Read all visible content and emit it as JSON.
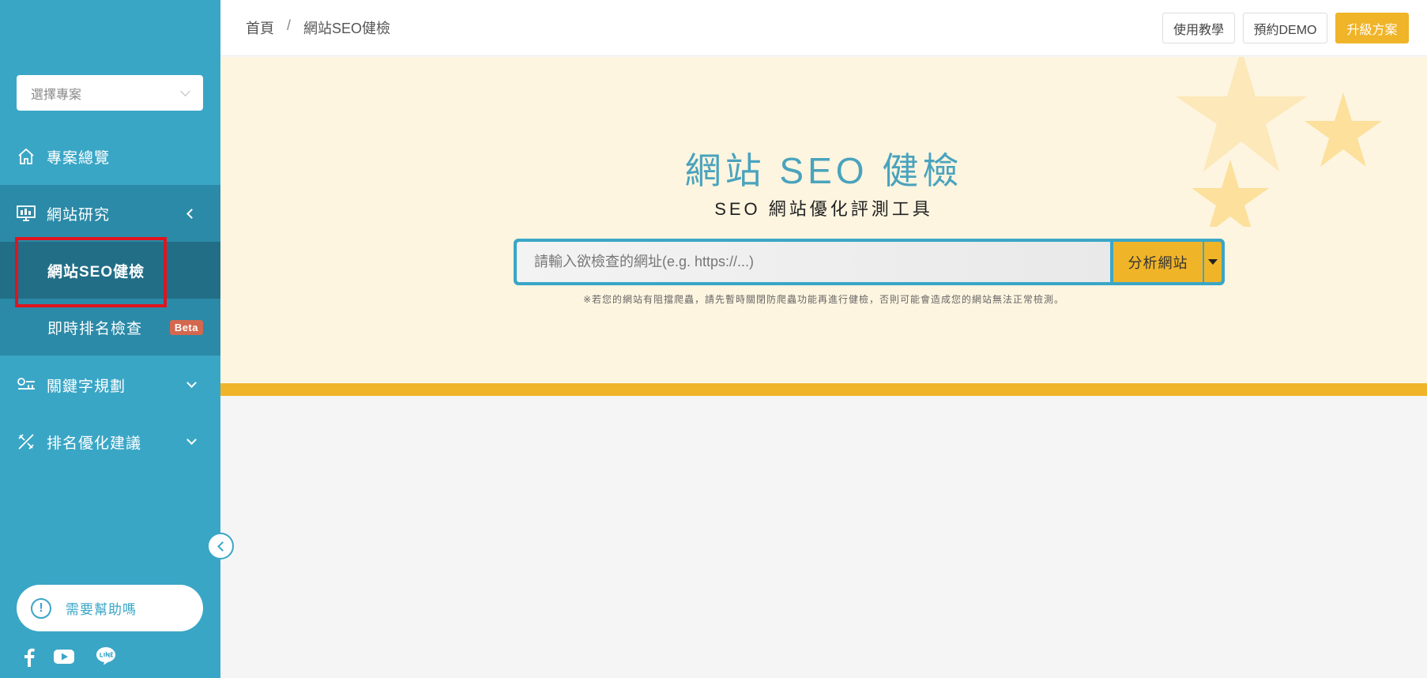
{
  "sidebar": {
    "project_select_placeholder": "選擇專案",
    "items": [
      {
        "label": "專案總覽",
        "icon": "home-icon"
      },
      {
        "label": "網站研究",
        "icon": "monitor-icon"
      },
      {
        "label": "關鍵字規劃",
        "icon": "keyword-icon"
      },
      {
        "label": "排名優化建議",
        "icon": "tools-icon"
      }
    ],
    "subitems": [
      {
        "label": "網站SEO健檢"
      },
      {
        "label": "即時排名檢查",
        "badge": "Beta"
      }
    ],
    "help_label": "需要幫助嗎",
    "help_icon_glyph": "!",
    "social": [
      "facebook-icon",
      "youtube-icon",
      "line-icon"
    ],
    "accent_color": "#3aa6c6"
  },
  "header": {
    "breadcrumb": [
      "首頁",
      "網站SEO健檢"
    ],
    "breadcrumb_sep": "/",
    "tutorial_label": "使用教學",
    "demo_label": "預約DEMO",
    "upgrade_label": "升級方案"
  },
  "hero": {
    "title": "網站 SEO 健檢",
    "subtitle": "SEO 網站優化評測工具",
    "search_placeholder": "請輸入欲檢查的網址(e.g. https://...)",
    "analyze_label": "分析網站",
    "note": "※若您的網站有阻擋爬蟲，請先暫時關閉防爬蟲功能再進行健檢，否則可能會造成您的網站無法正常檢測。",
    "accent_color": "#f0b428"
  }
}
